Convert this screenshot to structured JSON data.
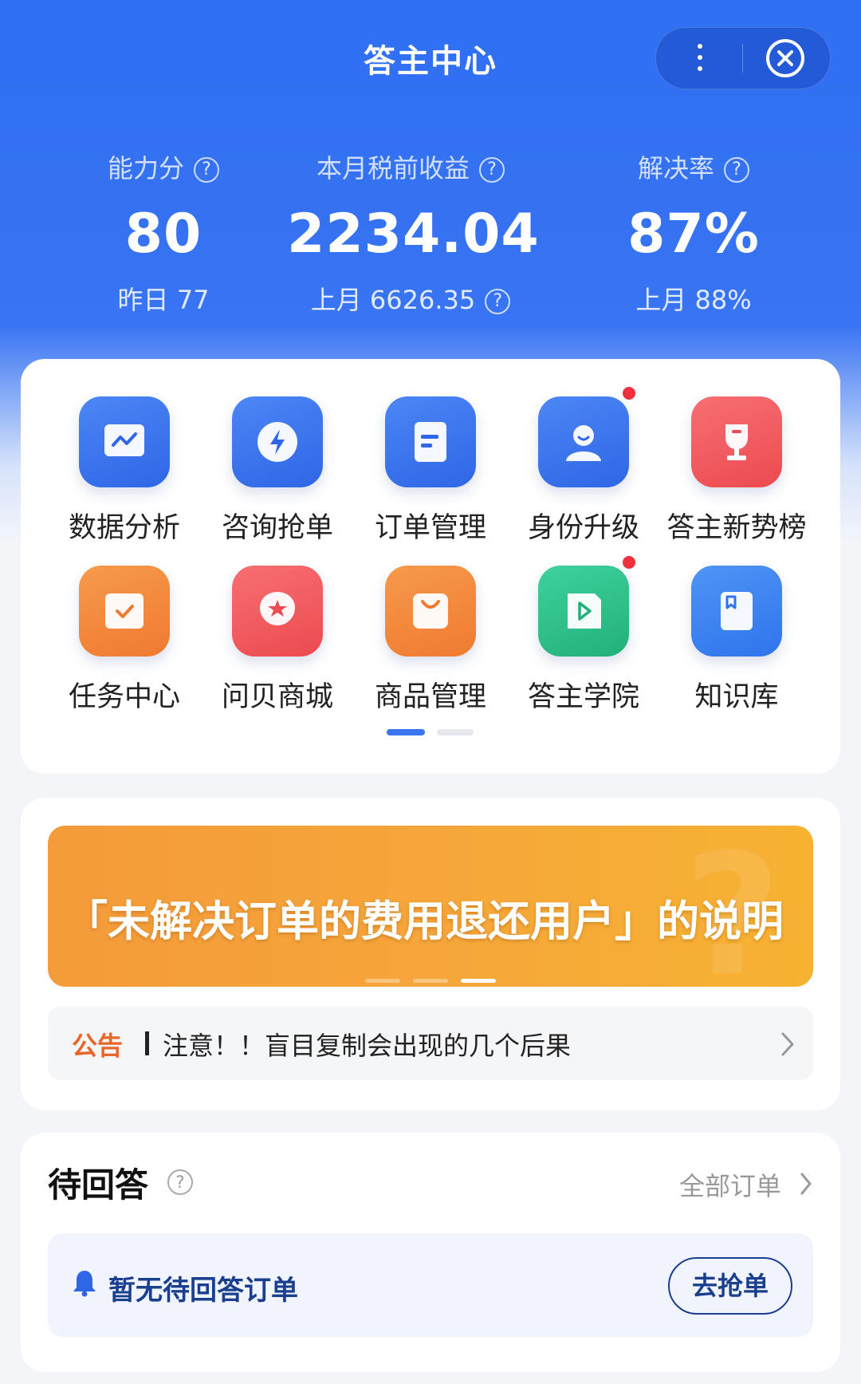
{
  "header": {
    "title": "答主中心",
    "more_icon": "more-vertical-icon",
    "close_icon": "close-circle-icon"
  },
  "stats": [
    {
      "label": "能力分",
      "value": "80",
      "sub": "昨日 77",
      "help": "?"
    },
    {
      "label": "本月税前收益",
      "value": "2234.04",
      "sub": "上月 6626.35",
      "help": "?",
      "sub_help": "?"
    },
    {
      "label": "解决率",
      "value": "87%",
      "sub": "上月 88%",
      "help": "?"
    }
  ],
  "menu": [
    {
      "label": "数据分析",
      "icon": "chart-icon",
      "color": "#3a74f0"
    },
    {
      "label": "咨询抢单",
      "icon": "lightning-icon",
      "color": "#3a74f0"
    },
    {
      "label": "订单管理",
      "icon": "document-icon",
      "color": "#3a74f0"
    },
    {
      "label": "身份升级",
      "icon": "user-badge-icon",
      "color": "#3a74f0",
      "badge": true
    },
    {
      "label": "答主新势榜",
      "icon": "trophy-icon",
      "color": "#f0555a"
    },
    {
      "label": "任务中心",
      "icon": "task-check-icon",
      "color": "#f28a3c"
    },
    {
      "label": "问贝商城",
      "icon": "shop-star-icon",
      "color": "#f0555a"
    },
    {
      "label": "商品管理",
      "icon": "bag-icon",
      "color": "#f28a3c"
    },
    {
      "label": "答主学院",
      "icon": "video-play-icon",
      "color": "#2fc08a",
      "badge": true
    },
    {
      "label": "知识库",
      "icon": "book-icon",
      "color": "#3a86f0"
    }
  ],
  "menu_pages": {
    "total": 2,
    "current": 1
  },
  "banner": {
    "text": "「未解决订单的费用退还用户」的说明",
    "watermark": "?",
    "slides": 3,
    "active_slide": 3
  },
  "announcement": {
    "tag": "公告",
    "text": "注意！！盲目复制会出现的几个后果"
  },
  "pending": {
    "title": "待回答",
    "help": "?",
    "link": "全部订单",
    "empty_text": "暂无待回答订单",
    "action": "去抢单"
  },
  "colors": {
    "primary": "#2f6ff2",
    "accent_orange": "#e8662a",
    "badge_red": "#f0303c",
    "dark_blue": "#1a3f8f"
  }
}
